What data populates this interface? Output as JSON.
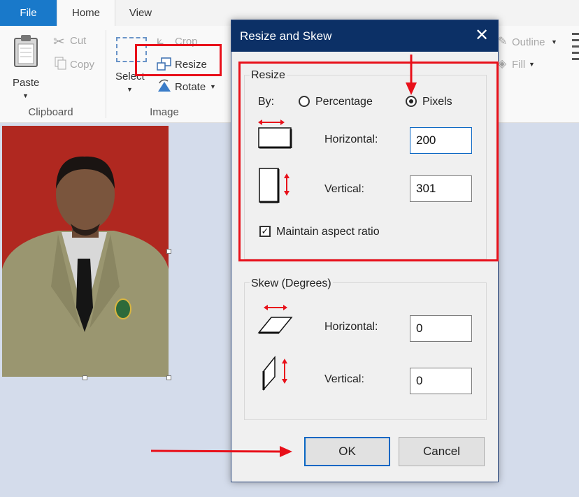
{
  "tabs": {
    "file": "File",
    "home": "Home",
    "view": "View"
  },
  "ribbon": {
    "clipboard": {
      "paste": "Paste",
      "cut": "Cut",
      "copy": "Copy",
      "label": "Clipboard"
    },
    "image": {
      "select": "Select",
      "crop": "Crop",
      "resize": "Resize",
      "rotate": "Rotate",
      "label": "Image"
    },
    "shapes": {
      "outline": "Outline",
      "fill": "Fill"
    }
  },
  "dialog": {
    "title": "Resize and Skew",
    "close_icon": "close-icon",
    "resize": {
      "group_label": "Resize",
      "by_label": "By:",
      "percentage_label": "Percentage",
      "pixels_label": "Pixels",
      "selected_unit": "Pixels",
      "horizontal_label": "Horizontal:",
      "horizontal_value": "200",
      "vertical_label": "Vertical:",
      "vertical_value": "301",
      "maintain_aspect_label": "Maintain aspect ratio",
      "maintain_aspect_checked": true
    },
    "skew": {
      "group_label": "Skew (Degrees)",
      "horizontal_label": "Horizontal:",
      "horizontal_value": "0",
      "vertical_label": "Vertical:",
      "vertical_value": "0"
    },
    "ok_label": "OK",
    "cancel_label": "Cancel"
  },
  "annotation_color": "#e8101a",
  "accent_color": "#1979ca"
}
